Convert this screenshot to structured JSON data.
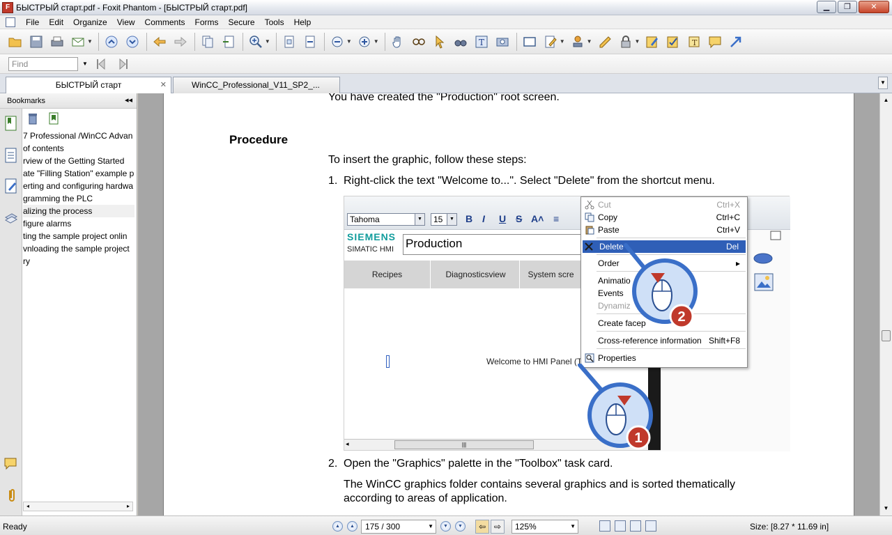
{
  "window": {
    "title": "БЫСТРЫЙ старт.pdf - Foxit Phantom - [БЫСТРЫЙ старт.pdf]",
    "minimize": "▁",
    "restore": "❐",
    "close": "✕"
  },
  "menu": [
    "File",
    "Edit",
    "Organize",
    "View",
    "Comments",
    "Forms",
    "Secure",
    "Tools",
    "Help"
  ],
  "find": {
    "placeholder": "Find"
  },
  "tabs": [
    {
      "label": "БЫСТРЫЙ старт",
      "close": "✕"
    },
    {
      "label": "WinCC_Professional_V11_SP2_..."
    }
  ],
  "bookmarks": {
    "header": "Bookmarks",
    "collapse": "◂◂",
    "items": [
      "7 Professional /WinCC Advan",
      " of contents",
      "rview of the Getting Started",
      "ate \"Filling Station\" example p",
      "erting and configuring hardwa",
      "gramming the PLC",
      "alizing the process",
      "figure alarms",
      "ting the sample project onlin",
      "vnloading the sample project",
      "ry"
    ],
    "selected_index": 6
  },
  "document": {
    "top_line": "You have created the \"Production\" root screen.",
    "procedure_heading": "Procedure",
    "intro": "To insert the graphic, follow these steps:",
    "step1_num": "1.",
    "step1": "Right-click the text \"Welcome to...\". Select \"Delete\" from the shortcut menu.",
    "step2_num": "2.",
    "step2": "Open the \"Graphics\" palette in the \"Toolbox\" task card.",
    "step2_desc_line1": "The WinCC graphics folder contains several graphics and is sorted thematically",
    "step2_desc_line2": "according to areas of application."
  },
  "embedded": {
    "font_name": "Tahoma",
    "font_size": "15",
    "format_buttons": [
      "B",
      "I",
      "U",
      "S",
      "A˄",
      "≡"
    ],
    "brand": "SIEMENS",
    "brand_sub": "SIMATIC HMI",
    "screen_title": "Production",
    "nav_buttons": [
      "Recipes",
      "Diagnosticsview",
      "System scre"
    ],
    "welcome_text": "Welcome to HMI Panel (T",
    "context_menu": [
      {
        "label": "Cut",
        "shortcut": "Ctrl+X",
        "disabled": true
      },
      {
        "label": "Copy",
        "shortcut": "Ctrl+C"
      },
      {
        "label": "Paste",
        "shortcut": "Ctrl+V"
      },
      {
        "label": "Delete",
        "shortcut": "Del",
        "highlighted": true
      },
      {
        "label": "Order",
        "shortcut": "▸"
      },
      {
        "label": "Animatio"
      },
      {
        "label": "Events"
      },
      {
        "label": "Dynamiz",
        "disabled": true
      },
      {
        "label": "Create facep"
      },
      {
        "label": "Cross-reference information",
        "shortcut": "Shift+F8"
      },
      {
        "label": "Properties"
      }
    ],
    "callout1": "1",
    "callout2": "2"
  },
  "status": {
    "ready": "Ready",
    "page": "175 / 300",
    "zoom": "125%",
    "size": "Size: [8.27 * 11.69 in]"
  },
  "colors": {
    "highlight": "#2f5fb7",
    "callout_blue": "#3a6fc8",
    "callout_red": "#c0392b"
  }
}
